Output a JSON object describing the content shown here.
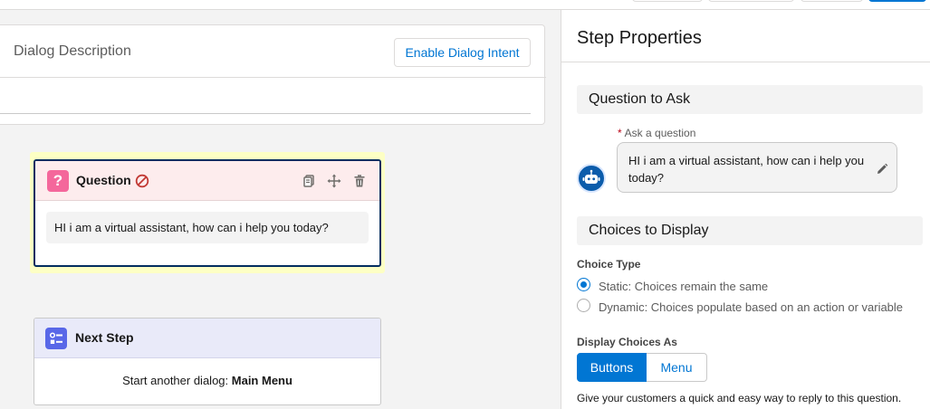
{
  "canvas": {
    "description_title": "Dialog Description",
    "enable_intent_label": "Enable Dialog Intent",
    "question_step": {
      "title": "Question",
      "message": "HI i am a virtual assistant, how can i help you today?",
      "icon_glyph": "?"
    },
    "next_step": {
      "title": "Next Step",
      "action_prefix": "Start another dialog: ",
      "action_target": "Main Menu"
    }
  },
  "panel": {
    "title": "Step Properties",
    "question_section": "Question to Ask",
    "ask_required_mark": "*",
    "ask_label": "Ask a question",
    "ask_value": "HI i am a virtual assistant, how can i help you today?",
    "choices_section": "Choices to Display",
    "choice_type_label": "Choice Type",
    "choice_types": [
      {
        "label": "Static: Choices remain the same",
        "selected": true
      },
      {
        "label": "Dynamic: Choices populate based on an action or variable",
        "selected": false
      }
    ],
    "display_as_label": "Display Choices As",
    "display_options": [
      "Buttons",
      "Menu"
    ],
    "display_selected": "Buttons",
    "help_text": "Give your customers a quick and easy way to reply to this question."
  },
  "colors": {
    "brand": "#0176d3",
    "question_accent": "#f4679b",
    "next_step_accent": "#5867e8",
    "error": "#c23934",
    "selected_border": "#032d60",
    "highlight": "#fdffc4"
  },
  "icons": {
    "question": "question-mark-icon",
    "error": "no-entry-icon",
    "copy": "copy-icon",
    "move": "move-icon",
    "delete": "trash-icon",
    "next_step": "list-icon",
    "avatar": "bot-avatar-icon",
    "edit": "pencil-icon"
  }
}
